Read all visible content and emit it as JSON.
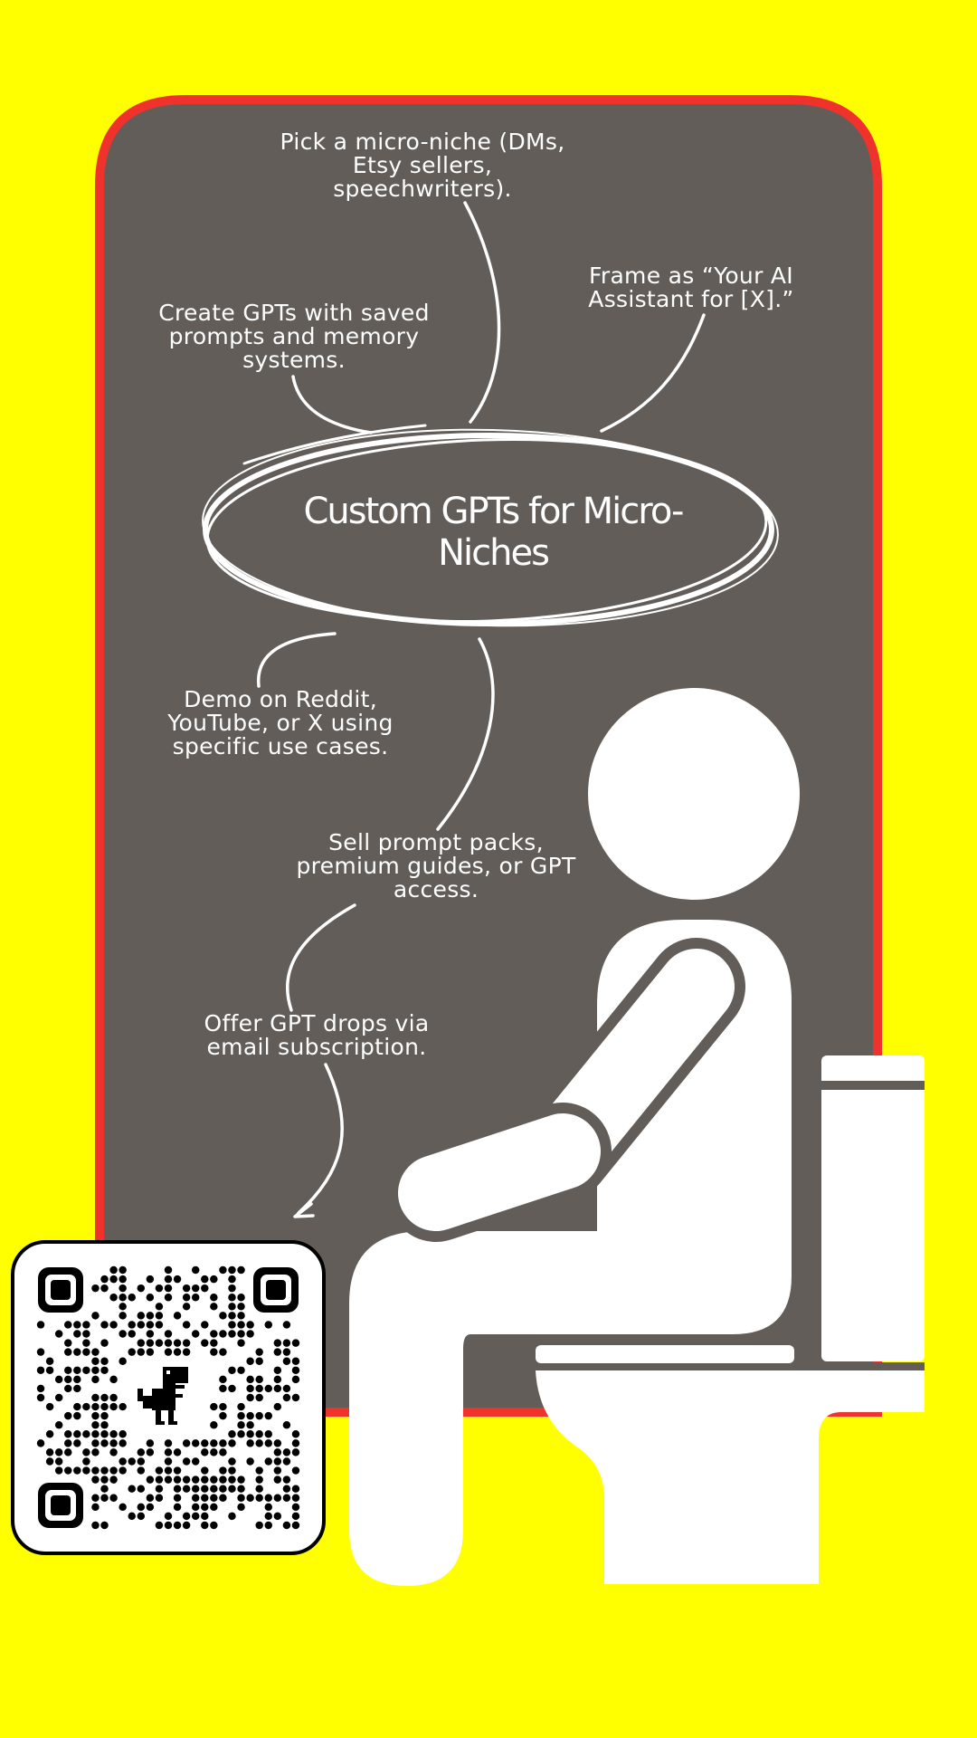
{
  "poster": {
    "colors": {
      "background": "#FFFF00",
      "panel": "#625D58",
      "panel_border": "#F0322C",
      "foreground": "#FFFFFF",
      "qr_ink": "#000000"
    },
    "central_topic": "Custom GPTs for Micro-Niches",
    "ideas": [
      {
        "text": "Pick a micro-niche (DMs, Etsy sellers, speechwriters)."
      },
      {
        "text": "Frame as “Your AI Assistant for [X].”"
      },
      {
        "text": "Create GPTs with saved prompts and memory systems."
      },
      {
        "text": "Demo on Reddit, YouTube, or X using specific use cases."
      },
      {
        "text": "Sell prompt packs, premium guides, or GPT access."
      },
      {
        "text": "Offer GPT drops via email subscription."
      }
    ],
    "icons": {
      "figure": "person-on-toilet-icon",
      "qr": "qr-code-icon",
      "qr_center": "dinosaur-icon",
      "arrow": "arrow-icon"
    }
  }
}
